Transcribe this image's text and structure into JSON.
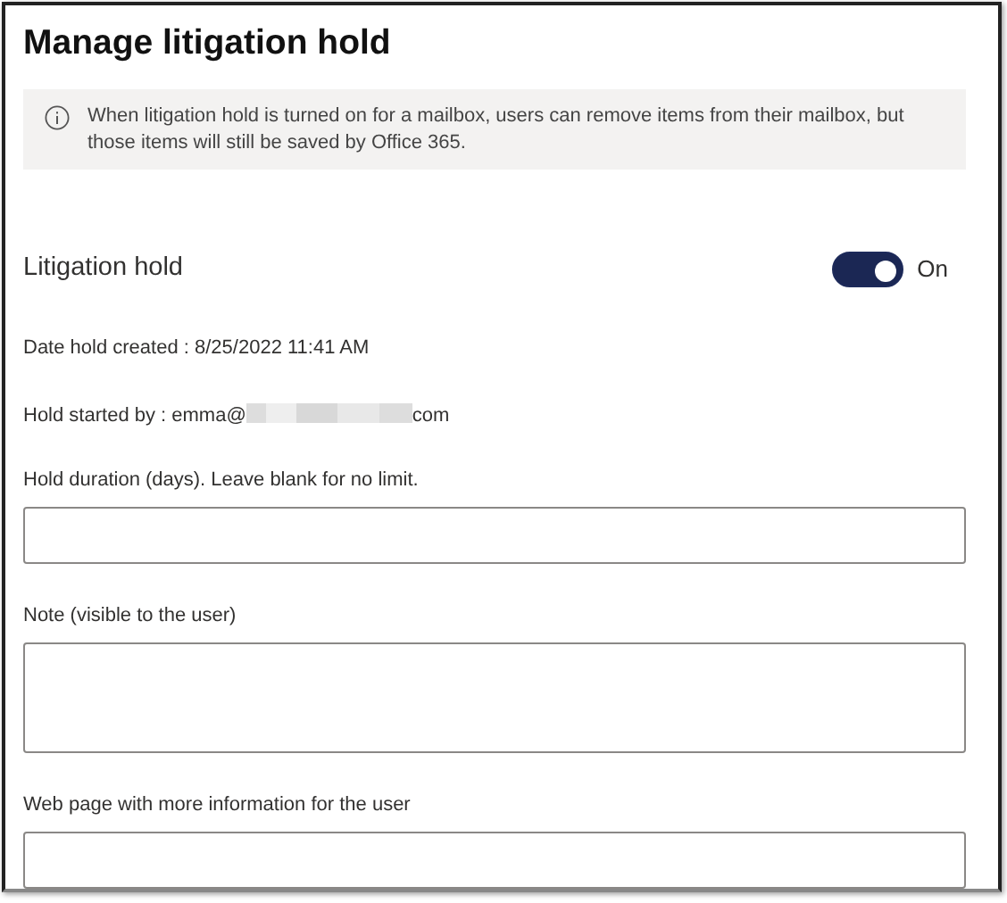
{
  "title": "Manage litigation hold",
  "info": {
    "text": "When litigation hold is turned on for a mailbox, users can remove items from their mailbox, but those items will still be saved by Office 365."
  },
  "litigation_hold": {
    "label": "Litigation hold",
    "on": true,
    "state_label": "On"
  },
  "details": [
    {
      "kind": "plain",
      "text": "Date hold created : 8/25/2022 11:41 AM"
    },
    {
      "kind": "redacted",
      "before": "Hold started by : emma@",
      "after": "com"
    }
  ],
  "fields": [
    {
      "kind": "input",
      "label": "Hold duration (days). Leave blank for no limit."
    },
    {
      "kind": "textarea",
      "label": "Note (visible to the user)"
    },
    {
      "kind": "input",
      "label": "Web page with more information for the user"
    }
  ]
}
